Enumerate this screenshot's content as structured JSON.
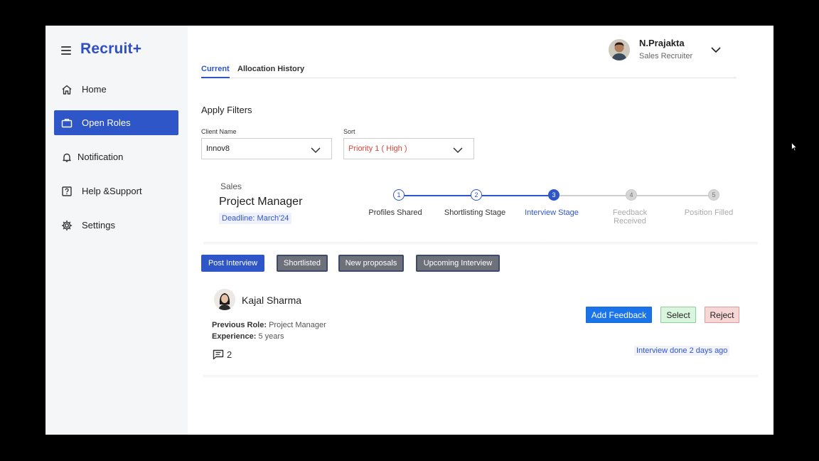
{
  "app": {
    "brand": "Recruit+"
  },
  "sidebar": {
    "items": [
      {
        "label": "Home",
        "icon": "home-icon",
        "active": false
      },
      {
        "label": "Open Roles",
        "icon": "briefcase-icon",
        "active": true
      },
      {
        "label": "Notification",
        "icon": "bell-icon",
        "active": false
      },
      {
        "label": "Help &Support",
        "icon": "help-icon",
        "active": false
      },
      {
        "label": "Settings",
        "icon": "gear-icon",
        "active": false
      }
    ]
  },
  "user": {
    "name": "N.Prajakta",
    "role": "Sales Recruiter"
  },
  "tabs": [
    {
      "label": "Current",
      "active": true
    },
    {
      "label": "Allocation History",
      "active": false
    }
  ],
  "filters": {
    "title": "Apply Filters",
    "client": {
      "label": "Client Name",
      "value": "Innov8"
    },
    "sort": {
      "label": "Sort",
      "value": "Priority 1 ( High )"
    }
  },
  "role": {
    "department": "Sales",
    "title": "Project Manager",
    "deadline": "Deadline: March'24"
  },
  "stepper": {
    "steps": [
      {
        "number": "1",
        "label": "Profiles Shared",
        "state": "done"
      },
      {
        "number": "2",
        "label": "Shortlisting Stage",
        "state": "done"
      },
      {
        "number": "3",
        "label": "Interview Stage",
        "state": "current"
      },
      {
        "number": "4",
        "label": "Feedback Received",
        "state": "todo"
      },
      {
        "number": "5",
        "label": "Position Filled",
        "state": "todo"
      }
    ]
  },
  "subfilters": [
    {
      "label": "Post Interview",
      "active": true
    },
    {
      "label": "Shortlisted",
      "active": false
    },
    {
      "label": "New proposals",
      "active": false
    },
    {
      "label": "Upcoming Interview",
      "active": false
    }
  ],
  "candidate": {
    "name": "Kajal Sharma",
    "previous_role_label": "Previous Role:",
    "previous_role": "Project Manager",
    "experience_label": "Experience:",
    "experience": "5 years",
    "comments": "2",
    "status": "Interview done 2 days ago",
    "actions": {
      "feedback": "Add Feedback",
      "select": "Select",
      "reject": "Reject"
    }
  },
  "colors": {
    "accent": "#2f56c9",
    "brand": "#2f4fc2",
    "primary_button": "#1a73e8",
    "select_bg": "#d9f5dd",
    "reject_bg": "#f7d6d6"
  }
}
